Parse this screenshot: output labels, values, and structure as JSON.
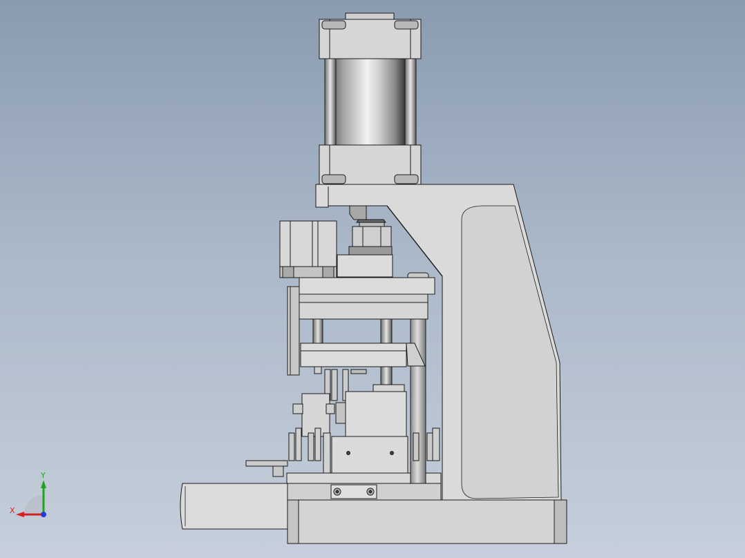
{
  "view": {
    "background_top": "#8a9bb0",
    "background_bottom": "#c6cfdb",
    "part_fill": "#d9d9d9",
    "part_stroke": "#1a1a1a"
  },
  "triad": {
    "x_label": "X",
    "y_label": "Y",
    "x_color": "#d42020",
    "y_color": "#1aa81a",
    "z_color": "#2a3ad8"
  }
}
